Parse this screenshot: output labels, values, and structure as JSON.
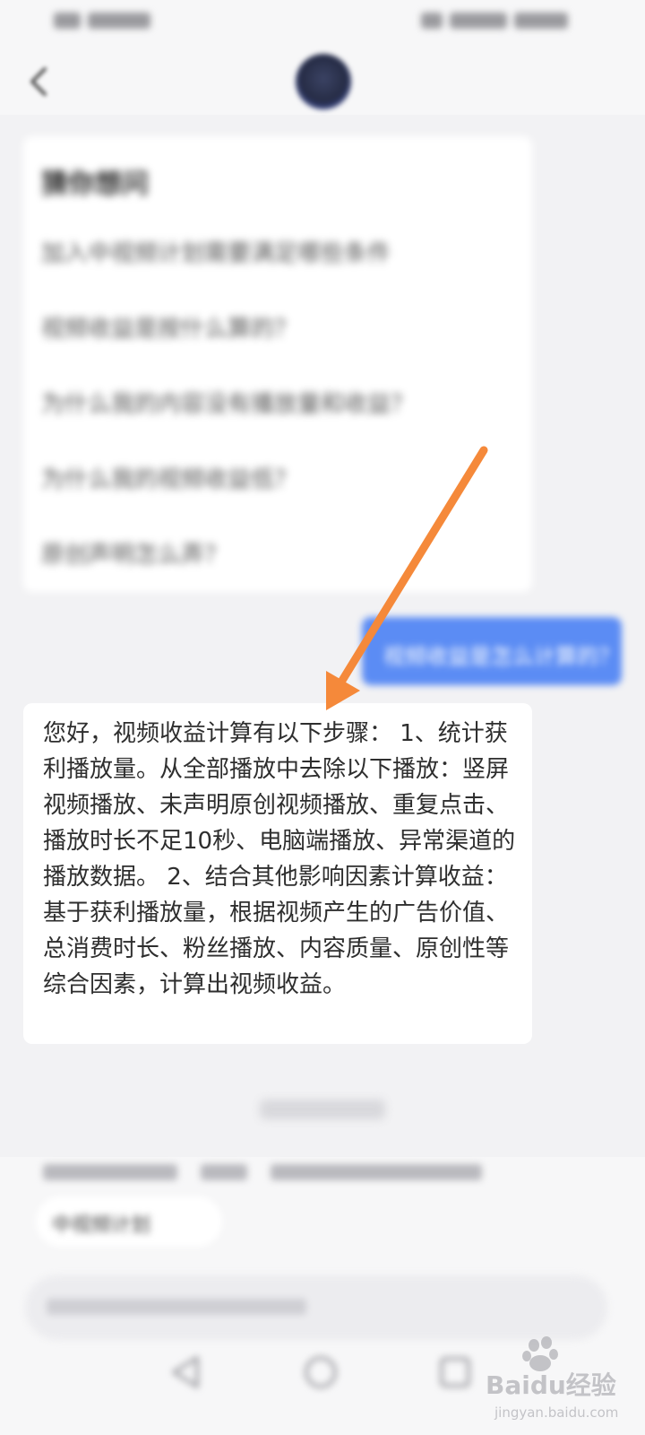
{
  "answer": {
    "text": "您好，视频收益计算有以下步骤： 1、统计获利播放量。从全部播放中去除以下播放：竖屏视频播放、未声明原创视频播放、重复点击、播放时长不足10秒、电脑端播放、异常渠道的播放数据。 2、结合其他影响因素计算收益：基于获利播放量，根据视频产生的广告价值、总消费时长、粉丝播放、内容质量、原创性等综合因素，计算出视频收益。"
  },
  "watermark": {
    "brand": "Baidu经验",
    "url": "jingyan.baidu.com"
  },
  "colors": {
    "accent": "#5b8cf4",
    "annotation_arrow": "#f5893a",
    "page_background": "#f2f2f4",
    "card_background": "#ffffff"
  }
}
